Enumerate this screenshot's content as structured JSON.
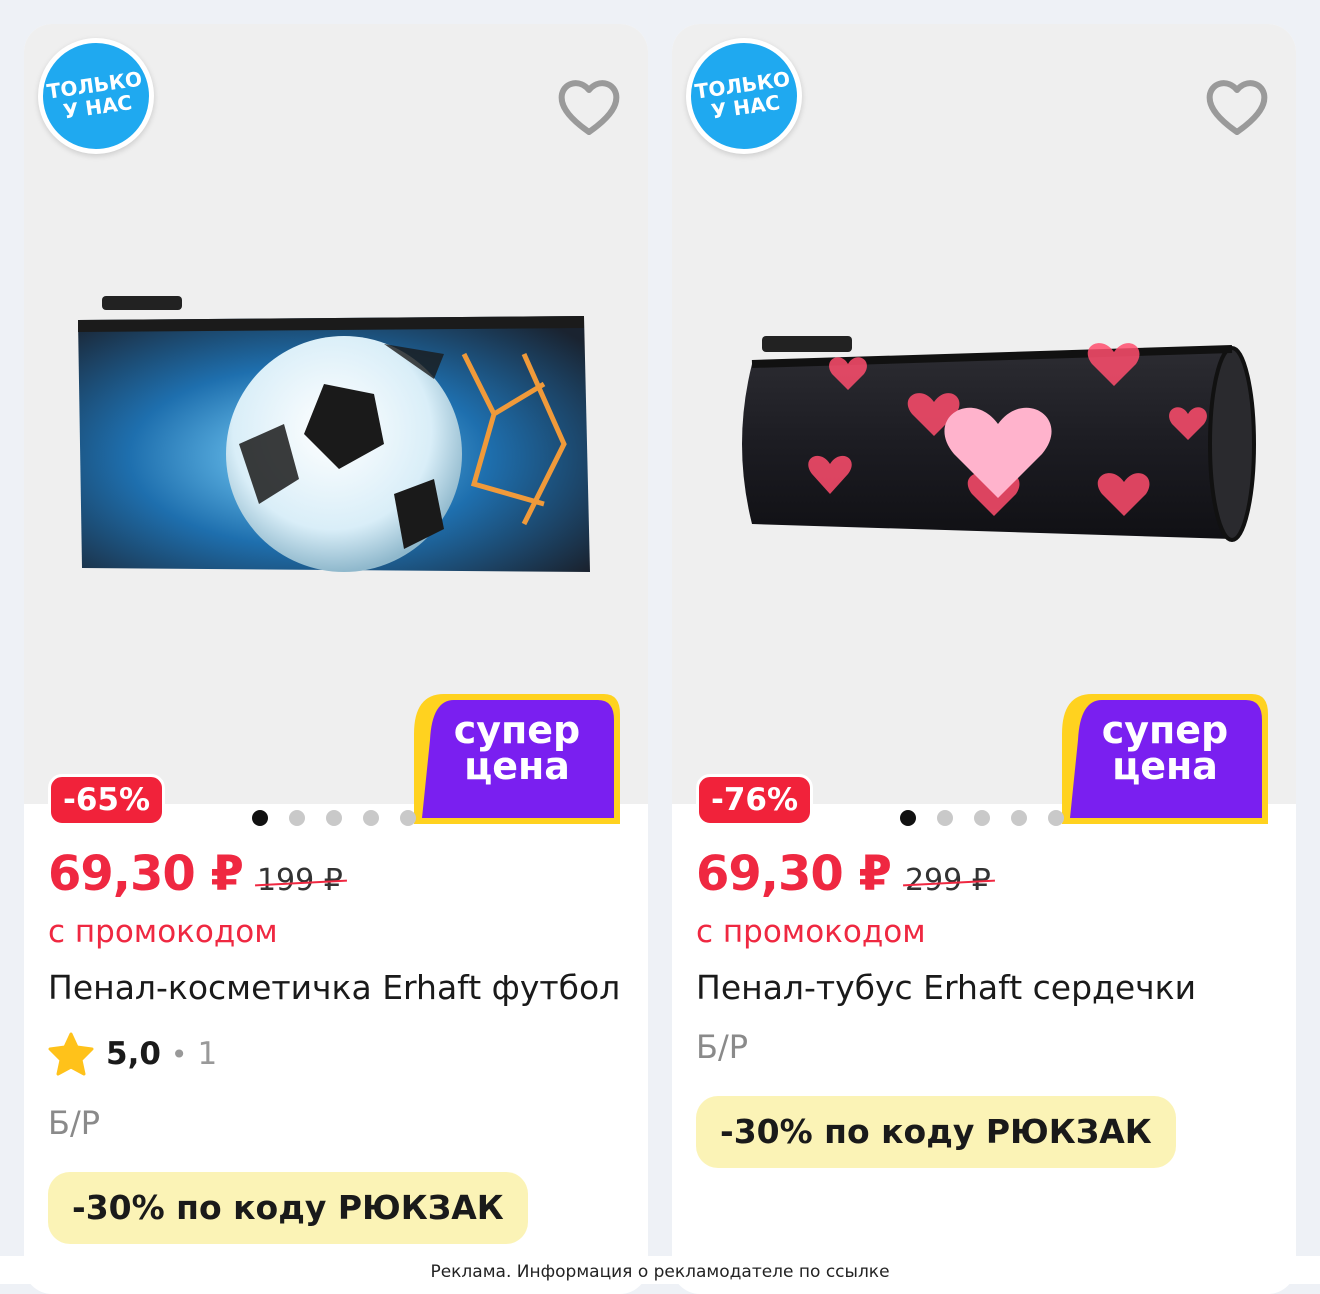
{
  "products": [
    {
      "badge_line1": "ТОЛЬКО",
      "badge_line2": "У НАС",
      "super_line1": "супер",
      "super_line2": "цена",
      "discount": "-65%",
      "price": "69,30 ₽",
      "old_price": "199 ₽",
      "promo": "с промокодом",
      "title": "Пенал-косметичка Erhaft футбол",
      "rating": "5,0",
      "rating_sep": "•",
      "reviews": "1",
      "brand": "Б/Р",
      "code": "-30% по коду РЮКЗАК",
      "image": "pencil-case-football"
    },
    {
      "badge_line1": "ТОЛЬКО",
      "badge_line2": "У НАС",
      "super_line1": "супер",
      "super_line2": "цена",
      "discount": "-76%",
      "price": "69,30 ₽",
      "old_price": "299 ₽",
      "promo": "с промокодом",
      "title": "Пенал-тубус Erhaft сердечки",
      "brand": "Б/Р",
      "code": "-30% по коду РЮКЗАК",
      "image": "pencil-case-hearts"
    }
  ],
  "ad_notice": "Реклама. Информация о рекламодателе по ссылке",
  "colors": {
    "accent_red": "#ef2841",
    "badge_blue": "#1fa9f0",
    "super_purple": "#7a1ff0",
    "super_yellow": "#ffd21f",
    "code_bg": "#fbf3b6"
  }
}
